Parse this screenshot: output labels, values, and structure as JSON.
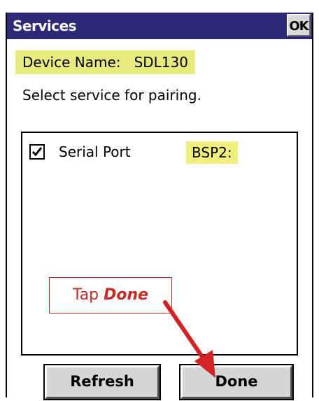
{
  "window": {
    "title": "Services",
    "ok_label": "OK"
  },
  "device": {
    "label": "Device Name:   SDL130"
  },
  "instruction": "Select service for pairing.",
  "services": [
    {
      "name": "Serial Port",
      "port": "BSP2:",
      "checked": true
    }
  ],
  "callout": {
    "prefix": "Tap ",
    "emphasis": "Done"
  },
  "buttons": {
    "refresh_label": "Refresh",
    "done_label": "Done"
  },
  "colors": {
    "titlebar": "#2c2a77",
    "highlight": "#e7ea7c",
    "callout_red": "#c82a2a",
    "button_face": "#d6d6d6"
  }
}
